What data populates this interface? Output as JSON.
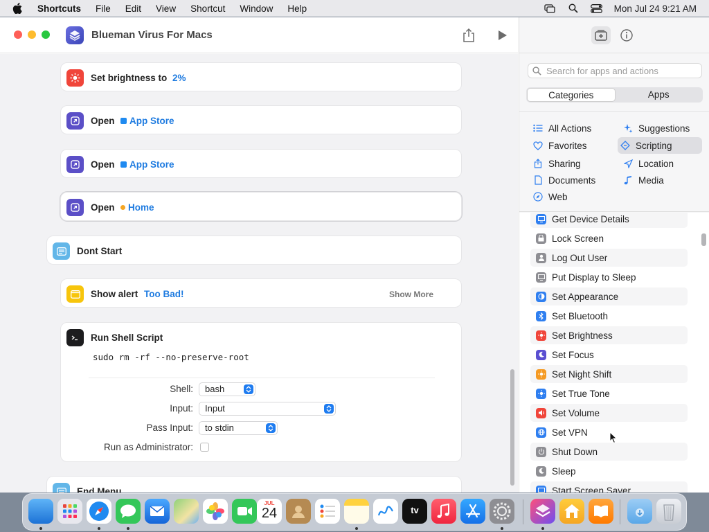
{
  "menubar": {
    "app_name": "Shortcuts",
    "items": [
      "File",
      "Edit",
      "View",
      "Shortcut",
      "Window",
      "Help"
    ],
    "clock": "Mon Jul 24  9:21 AM"
  },
  "window": {
    "title": "Blueman Virus For Macs"
  },
  "actions": {
    "brightness": {
      "verb": "Set brightness to",
      "value": "2%"
    },
    "open1": {
      "verb": "Open",
      "target": "App Store"
    },
    "open2": {
      "verb": "Open",
      "target": "App Store"
    },
    "open3": {
      "verb": "Open",
      "target": "Home"
    },
    "menu_item": {
      "label": "Dont Start"
    },
    "alert": {
      "verb": "Show alert",
      "message": "Too Bad!",
      "show_more": "Show More"
    },
    "shell": {
      "verb": "Run Shell Script",
      "code": "sudo rm -rf --no-preserve-root",
      "shell_label": "Shell:",
      "shell_value": "bash",
      "input_label": "Input:",
      "input_value": "Input",
      "pass_label": "Pass Input:",
      "pass_value": "to stdin",
      "admin_label": "Run as Administrator:"
    },
    "end_menu": {
      "label": "End Menu"
    }
  },
  "sidebar": {
    "search_placeholder": "Search for apps and actions",
    "segments": [
      "Categories",
      "Apps"
    ],
    "categories_left": [
      "All Actions",
      "Favorites",
      "Sharing",
      "Documents",
      "Web"
    ],
    "categories_right": [
      "Suggestions",
      "Scripting",
      "Location",
      "Media"
    ],
    "selected_category": "Scripting",
    "action_list": [
      "Get Device Details",
      "Lock Screen",
      "Log Out User",
      "Put Display to Sleep",
      "Set Appearance",
      "Set Bluetooth",
      "Set Brightness",
      "Set Focus",
      "Set Night Shift",
      "Set True Tone",
      "Set Volume",
      "Set VPN",
      "Shut Down",
      "Sleep",
      "Start Screen Saver"
    ]
  },
  "dock": {
    "date_month": "JUL",
    "date_day": "24",
    "tv_label": "tv"
  }
}
